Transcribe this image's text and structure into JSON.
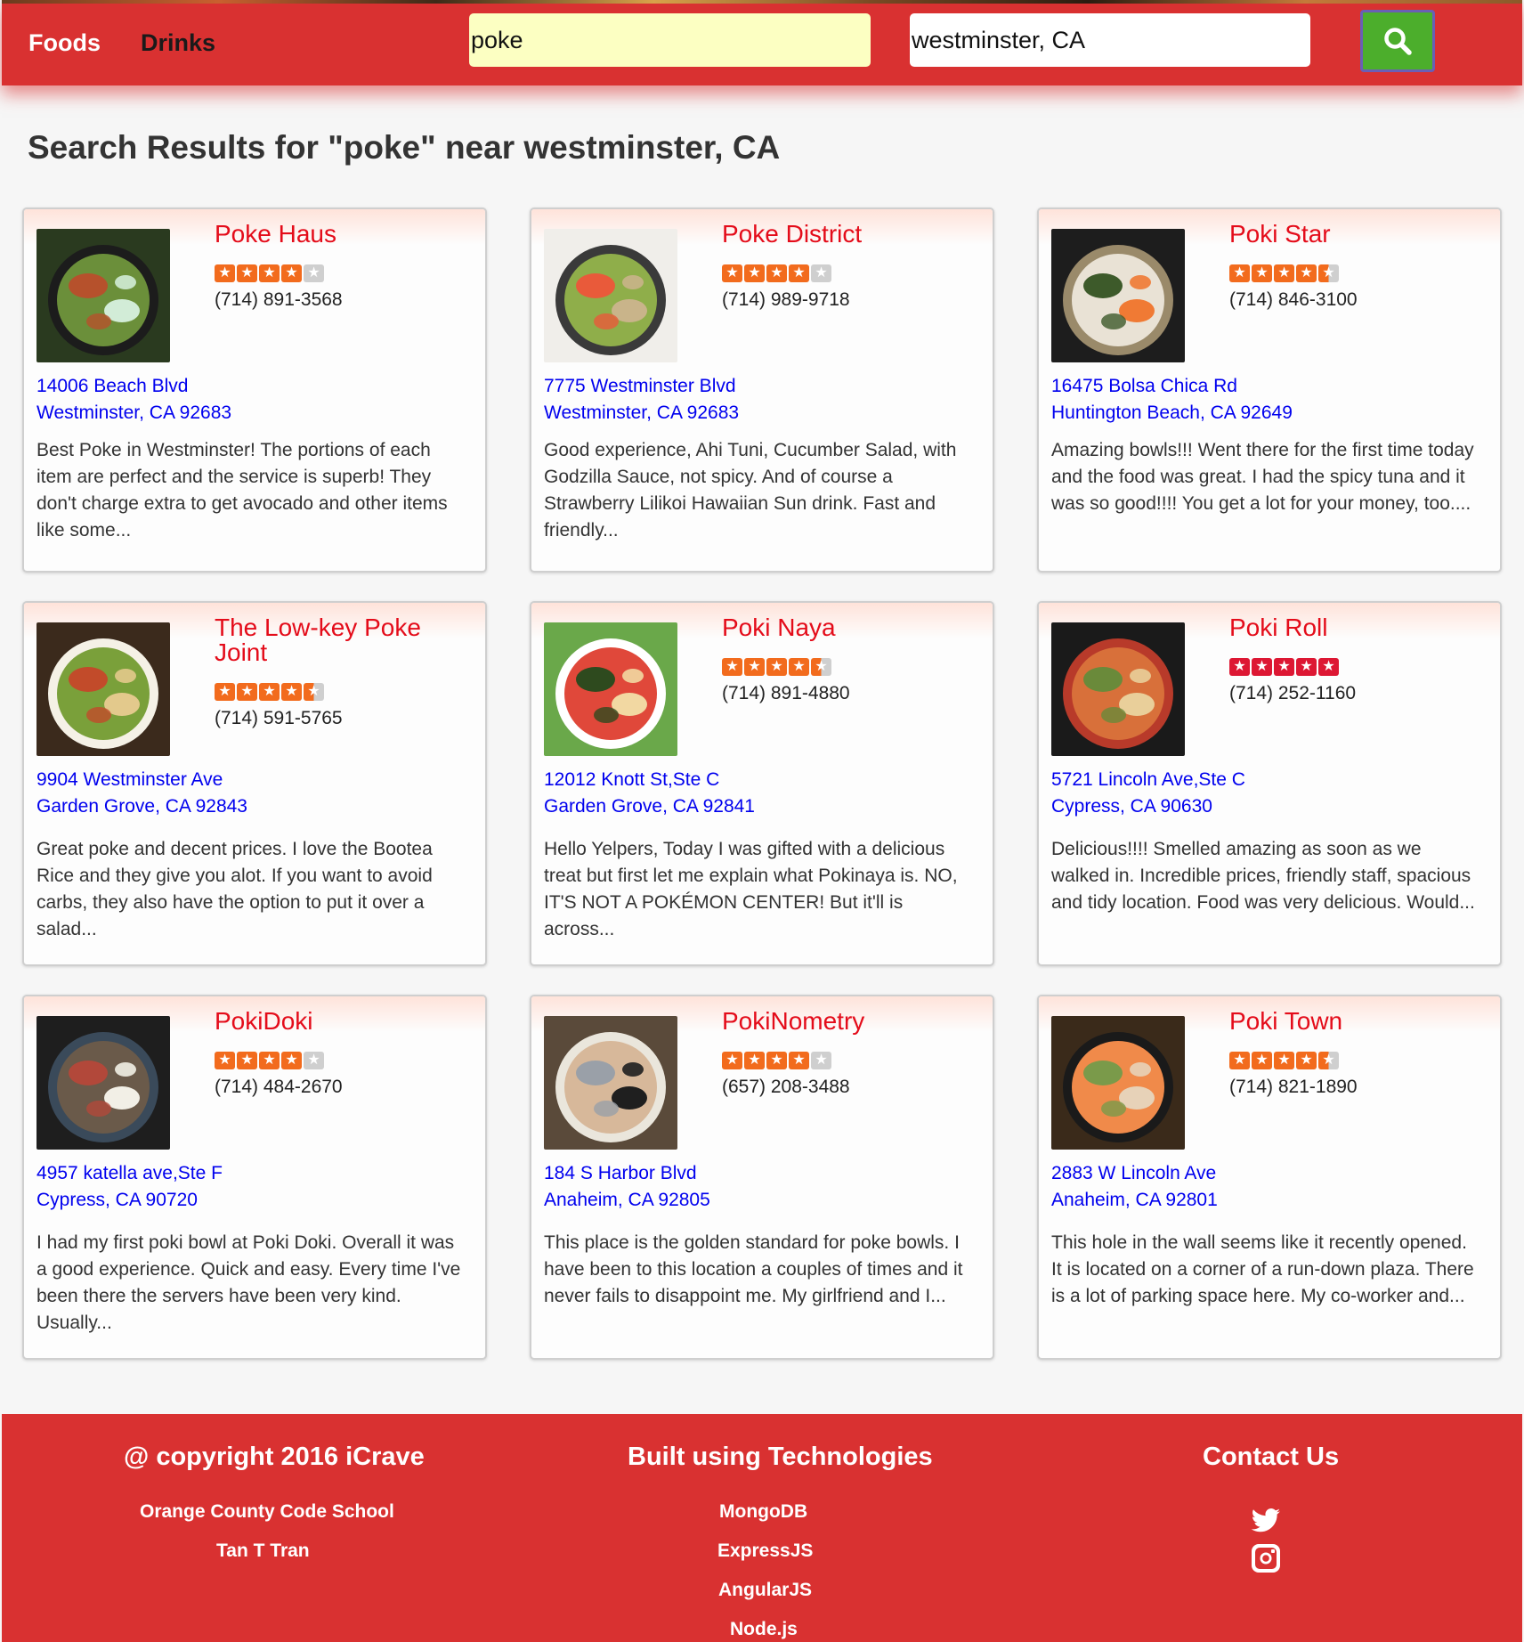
{
  "nav": {
    "foods": "Foods",
    "drinks": "Drinks"
  },
  "search": {
    "term": "poke",
    "location": "westminster, CA",
    "button_icon": "search-icon"
  },
  "results_title": "Search Results for \"poke\" near westminster, CA",
  "colors": {
    "brand_red": "#d93131",
    "name_red": "#e40c1a",
    "link_blue": "#0000ee",
    "search_green": "#4cae2c",
    "star_orange": "#f26b1d"
  },
  "results": [
    {
      "name": "Poke Haus",
      "rating": 4,
      "phone": "(714) 891-3568",
      "address1": "14006 Beach Blvd",
      "address2": "Westminster, CA 92683",
      "snippet": "Best Poke in Westminster! The portions of each item are perfect and the service is superb! They don't charge extra to get avocado and other items like some..."
    },
    {
      "name": "Poke District",
      "rating": 4,
      "phone": "(714) 989-9718",
      "address1": "7775 Westminster Blvd",
      "address2": "Westminster, CA 92683",
      "snippet": "Good experience, Ahi Tuni, Cucumber Salad, with Godzilla Sauce, not spicy. And of course a Strawberry Lilikoi Hawaiian Sun drink. Fast and friendly..."
    },
    {
      "name": "Poki Star",
      "rating": 4.5,
      "phone": "(714) 846-3100",
      "address1": "16475 Bolsa Chica Rd",
      "address2": "Huntington Beach, CA 92649",
      "snippet": "Amazing bowls!!! Went there for the first time today and the food was great. I had the spicy tuna and it was so good!!!! You get a lot for your money, too...."
    },
    {
      "name": "The Low-key Poke Joint",
      "rating": 4.5,
      "phone": "(714) 591-5765",
      "address1": "9904 Westminster Ave",
      "address2": "Garden Grove, CA 92843",
      "snippet": "Great poke and decent prices. I love the Bootea Rice and they give you alot. If you want to avoid carbs, they also have the option to put it over a salad..."
    },
    {
      "name": "Poki Naya",
      "rating": 4.5,
      "phone": "(714) 891-4880",
      "address1": "12012 Knott St,Ste C",
      "address2": "Garden Grove, CA 92841",
      "snippet": "Hello Yelpers, Today I was gifted with a delicious treat but first let me explain what Pokinaya is. NO, IT'S NOT A POKÉMON CENTER! But it'll is across..."
    },
    {
      "name": "Poki Roll",
      "rating": 5,
      "phone": "(714) 252-1160",
      "address1": "5721 Lincoln Ave,Ste C",
      "address2": "Cypress, CA 90630",
      "snippet": "Delicious!!!! Smelled amazing as soon as we walked in. Incredible prices, friendly staff, spacious and tidy location. Food was very delicious. Would..."
    },
    {
      "name": "PokiDoki",
      "rating": 4,
      "phone": "(714) 484-2670",
      "address1": "4957 katella ave,Ste F",
      "address2": "Cypress, CA 90720",
      "snippet": "I had my first poki bowl at Poki Doki. Overall it was a good experience. Quick and easy. Every time I've been there the servers have been very kind. Usually..."
    },
    {
      "name": "PokiNometry",
      "rating": 4,
      "phone": "(657) 208-3488",
      "address1": "184 S Harbor Blvd",
      "address2": "Anaheim, CA 92805",
      "snippet": "This place is the golden standard for poke bowls. I have been to this location a couples of times and it never fails to disappoint me. My girlfriend and I..."
    },
    {
      "name": "Poki Town",
      "rating": 4.5,
      "phone": "(714) 821-1890",
      "address1": "2883 W Lincoln Ave",
      "address2": "Anaheim, CA 92801",
      "snippet": "This hole in the wall seems like it recently opened. It is located on a corner of a run-down plaza. There is a lot of parking space here. My co-worker and..."
    }
  ],
  "footer": {
    "copyright": "@ copyright 2016 iCrave",
    "school": "Orange County Code School",
    "author": "Tan T Tran",
    "tech_heading": "Built using Technologies",
    "techs": [
      "MongoDB",
      "ExpressJS",
      "AngularJS",
      "Node.js"
    ],
    "contact_heading": "Contact Us",
    "contact_icons": [
      "twitter-icon",
      "instagram-icon"
    ]
  }
}
